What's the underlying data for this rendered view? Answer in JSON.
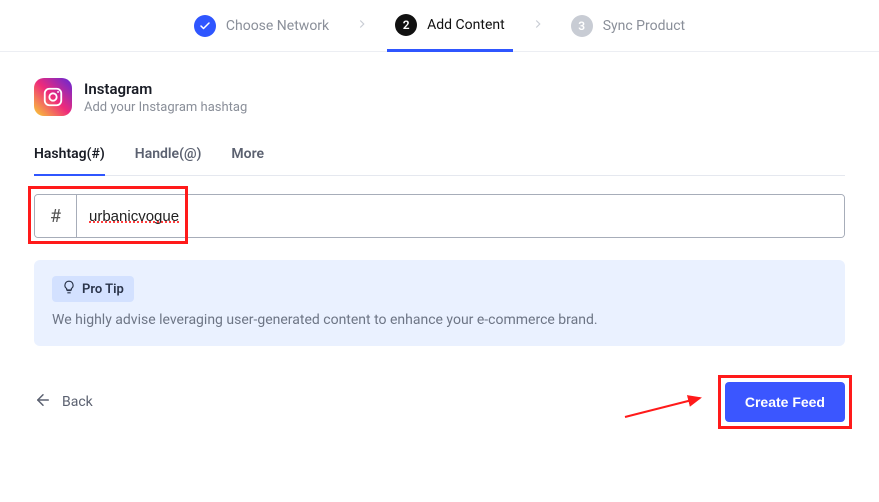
{
  "stepper": {
    "steps": [
      {
        "label": "Choose Network",
        "state": "done"
      },
      {
        "label": "Add Content",
        "state": "active",
        "number": "2"
      },
      {
        "label": "Sync Product",
        "state": "pending",
        "number": "3"
      }
    ]
  },
  "source": {
    "name": "Instagram",
    "subtitle": "Add your Instagram hashtag"
  },
  "input_tabs": {
    "items": [
      {
        "label": "Hashtag(#)",
        "active": true
      },
      {
        "label": "Handle(@)",
        "active": false
      },
      {
        "label": "More",
        "active": false
      }
    ]
  },
  "hashtag_input": {
    "prefix": "#",
    "value": "urbanicvogue"
  },
  "pro_tip": {
    "badge": "Pro Tip",
    "text": "We highly advise leveraging user-generated content to enhance your e-commerce brand."
  },
  "footer": {
    "back": "Back",
    "create": "Create Feed"
  }
}
